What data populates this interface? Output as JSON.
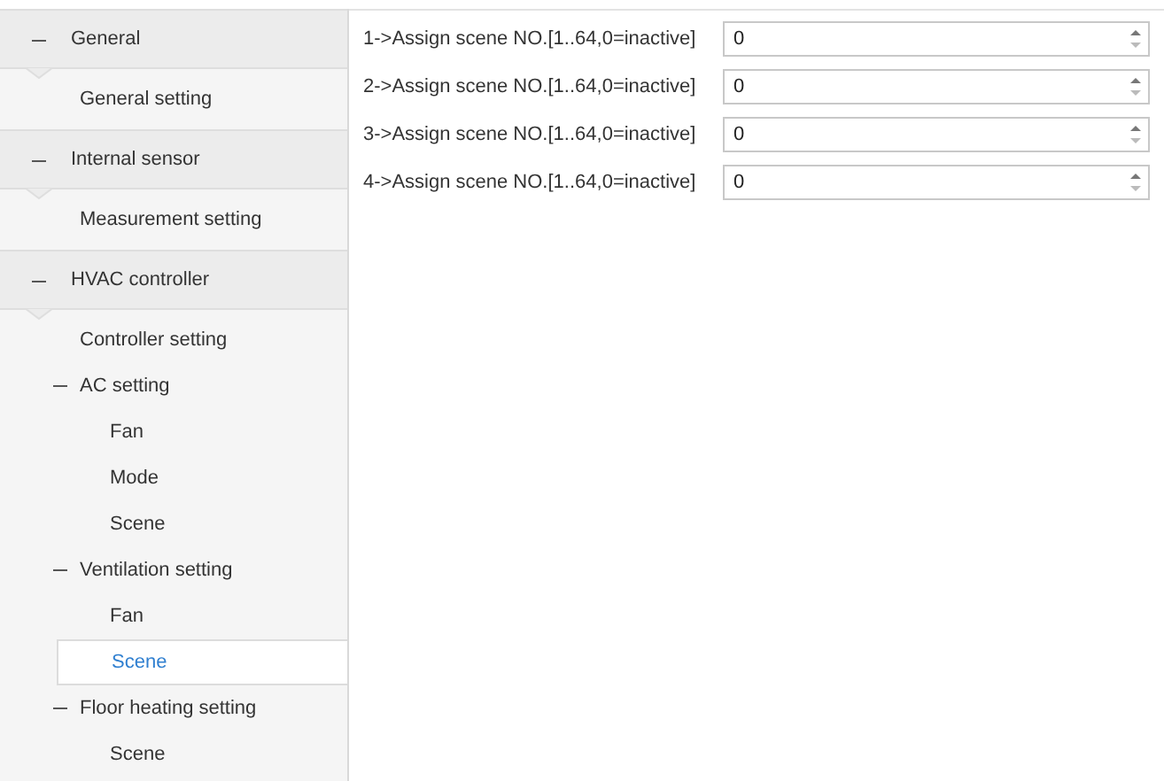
{
  "sidebar": {
    "sections": [
      {
        "label": "General",
        "expanded": true,
        "items": [
          {
            "label": "General setting",
            "selected": false
          }
        ]
      },
      {
        "label": "Internal sensor",
        "expanded": true,
        "items": [
          {
            "label": "Measurement setting",
            "selected": false
          }
        ]
      },
      {
        "label": "HVAC controller",
        "expanded": true,
        "items": [
          {
            "label": "Controller setting",
            "selected": false
          },
          {
            "label": "AC setting",
            "selected": false,
            "expanded": true,
            "children": [
              {
                "label": "Fan",
                "selected": false
              },
              {
                "label": "Mode",
                "selected": false
              },
              {
                "label": "Scene",
                "selected": false
              }
            ]
          },
          {
            "label": "Ventilation setting",
            "selected": false,
            "expanded": true,
            "children": [
              {
                "label": "Fan",
                "selected": false
              },
              {
                "label": "Scene",
                "selected": true
              }
            ]
          },
          {
            "label": "Floor heating setting",
            "selected": false,
            "expanded": true,
            "children": [
              {
                "label": "Scene",
                "selected": false
              }
            ]
          }
        ]
      }
    ]
  },
  "parameters": [
    {
      "label": "1->Assign scene NO.[1..64,0=inactive]",
      "value": "0"
    },
    {
      "label": "2->Assign scene NO.[1..64,0=inactive]",
      "value": "0"
    },
    {
      "label": "3->Assign scene NO.[1..64,0=inactive]",
      "value": "0"
    },
    {
      "label": "4->Assign scene NO.[1..64,0=inactive]",
      "value": "0"
    }
  ]
}
